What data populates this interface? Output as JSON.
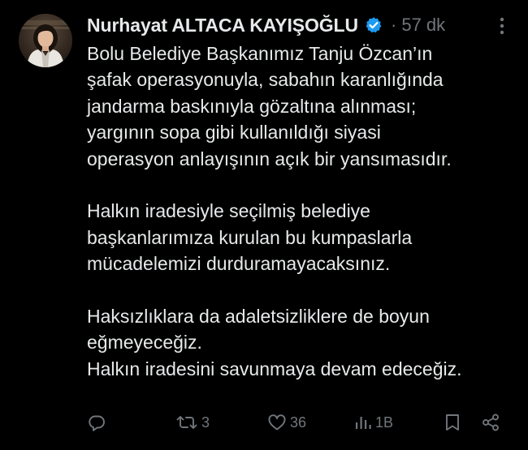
{
  "tweet": {
    "author_name": "Nurhayat ALTACA KAYIŞOĞLU",
    "separator": "·",
    "time": "57 dk",
    "verified_icon": "verified-badge-icon",
    "accent_color": "#1d9bf0",
    "text_lines": [
      "Bolu Belediye Başkanımız Tanju Özcan’ın",
      "şafak operasyonuyla, sabahın karanlığında",
      "jandarma baskınıyla gözaltına alınması;",
      "yargının sopa gibi kullanıldığı siyasi",
      "operasyon anlayışının açık bir yansımasıdır.",
      "",
      "Halkın iradesiyle seçilmiş belediye",
      "başkanlarımıza kurulan bu kumpaslarla",
      "mücadelemizi durduramayacaksınız.",
      "",
      "Haksızlıklara da adaletsizliklere de boyun",
      "eğmeyeceğiz.",
      "Halkın iradesini savunmaya devam edeceğiz."
    ],
    "actions": {
      "reply": {
        "icon": "reply-icon",
        "count": ""
      },
      "retweet": {
        "icon": "retweet-icon",
        "count": "3"
      },
      "like": {
        "icon": "heart-icon",
        "count": "36"
      },
      "views": {
        "icon": "views-icon",
        "count": "1B"
      },
      "bookmark": {
        "icon": "bookmark-icon",
        "count": ""
      },
      "share": {
        "icon": "share-icon",
        "count": ""
      }
    }
  }
}
